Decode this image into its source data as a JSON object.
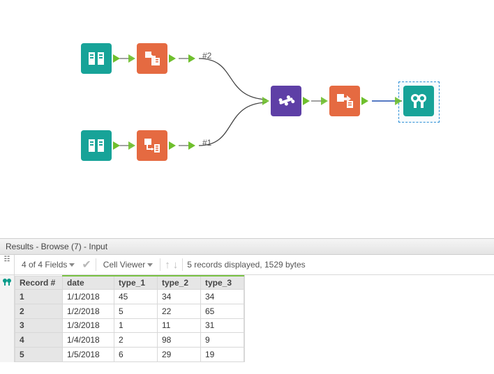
{
  "canvas": {
    "tool_input_top": {
      "type": "Input",
      "color": "#17a398"
    },
    "tool_input_bottom": {
      "type": "Input",
      "color": "#17a398"
    },
    "tool_select_top": {
      "type": "Select",
      "color": "#e56a41"
    },
    "tool_select_bottom": {
      "type": "Select",
      "color": "#e56a41"
    },
    "tool_union": {
      "type": "Union",
      "color": "#5e3fa6"
    },
    "tool_select_mid": {
      "type": "Select",
      "color": "#e56a41"
    },
    "tool_browse": {
      "type": "Browse",
      "color": "#17a398"
    },
    "anchor_top": "#2",
    "anchor_bottom": "#1"
  },
  "results": {
    "title": "Results - Browse (7) - Input",
    "fields_label": "4 of 4 Fields",
    "cell_viewer_label": "Cell Viewer",
    "status": "5 records displayed, 1529 bytes",
    "columns": {
      "c0": "Record #",
      "c1": "date",
      "c2": "type_1",
      "c3": "type_2",
      "c4": "type_3"
    },
    "rows": [
      {
        "n": "1",
        "date": "1/1/2018",
        "t1": "45",
        "t2": "34",
        "t3": "34"
      },
      {
        "n": "2",
        "date": "1/2/2018",
        "t1": "5",
        "t2": "22",
        "t3": "65"
      },
      {
        "n": "3",
        "date": "1/3/2018",
        "t1": "1",
        "t2": "11",
        "t3": "31"
      },
      {
        "n": "4",
        "date": "1/4/2018",
        "t1": "2",
        "t2": "98",
        "t3": "9"
      },
      {
        "n": "5",
        "date": "1/5/2018",
        "t1": "6",
        "t2": "29",
        "t3": "19"
      }
    ]
  }
}
